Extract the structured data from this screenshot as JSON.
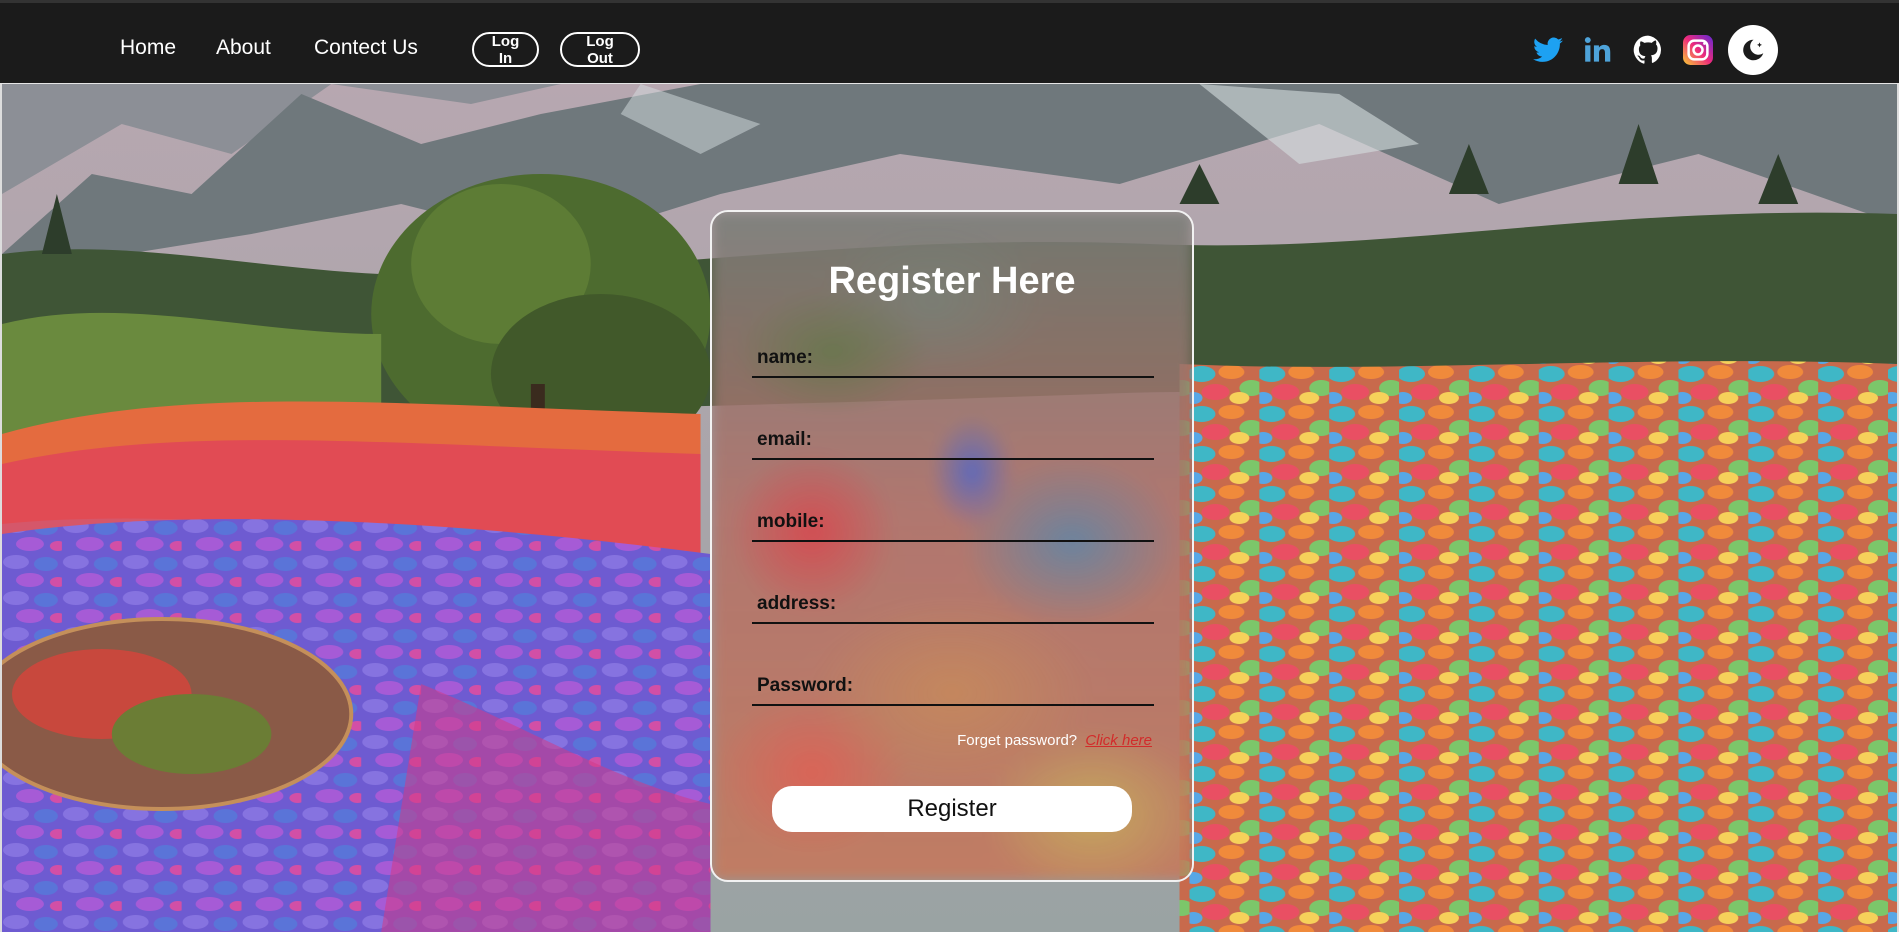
{
  "nav": {
    "links": [
      "Home",
      "About",
      "Contect Us"
    ],
    "login_label": "Log In",
    "logout_label": "Log Out"
  },
  "social": {
    "icons": [
      "twitter-icon",
      "linkedin-icon",
      "github-icon",
      "instagram-icon"
    ],
    "twitter_color": "#1da1f2",
    "linkedin_color": "#4ea3d9",
    "instagram_colors": [
      "#f9ce34",
      "#ee2a7b",
      "#6228d7"
    ]
  },
  "theme_toggle": {
    "icon": "moon-icon"
  },
  "form": {
    "title": "Register Here",
    "fields": [
      {
        "placeholder": "name:"
      },
      {
        "placeholder": "email:"
      },
      {
        "placeholder": "mobile:"
      },
      {
        "placeholder": "address:"
      },
      {
        "placeholder": "Password:"
      }
    ],
    "forgot_text": "Forget password?",
    "forgot_link": "Click here",
    "submit_label": "Register"
  },
  "colors": {
    "header_bg": "#1b1b1b",
    "link_red": "#d22b2b"
  }
}
